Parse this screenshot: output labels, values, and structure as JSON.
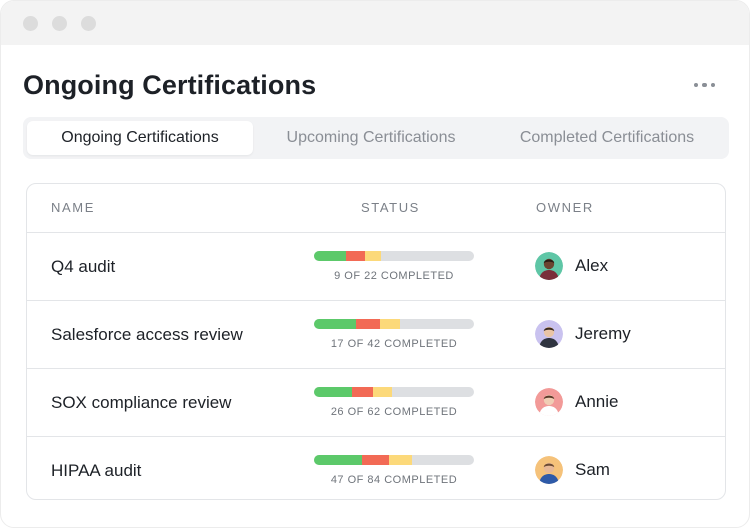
{
  "header": {
    "title": "Ongoing Certifications"
  },
  "tabs": [
    {
      "label": "Ongoing Certifications",
      "active": true
    },
    {
      "label": "Upcoming Certifications",
      "active": false
    },
    {
      "label": "Completed Certifications",
      "active": false
    }
  ],
  "table": {
    "columns": {
      "name": "NAME",
      "status": "STATUS",
      "owner": "OWNER"
    },
    "rows": [
      {
        "name": "Q4 audit",
        "status_text": "9 OF 22 COMPLETED",
        "progress": {
          "green": 0.2,
          "red": 0.12,
          "yellow": 0.1
        },
        "owner": "Alex",
        "avatar_bg": "#5fc6a6",
        "skin": "#6b4430",
        "hair": "#2a1c14",
        "shirt": "#7a2e3a"
      },
      {
        "name": "Salesforce access review",
        "status_text": "17 OF 42 COMPLETED",
        "progress": {
          "green": 0.26,
          "red": 0.15,
          "yellow": 0.13
        },
        "owner": "Jeremy",
        "avatar_bg": "#c9c2ef",
        "skin": "#e9c4a6",
        "hair": "#3a2a20",
        "shirt": "#2f3440"
      },
      {
        "name": "SOX compliance review",
        "status_text": "26 OF 62 COMPLETED",
        "progress": {
          "green": 0.24,
          "red": 0.13,
          "yellow": 0.12
        },
        "owner": "Annie",
        "avatar_bg": "#f29a98",
        "skin": "#f0cdb4",
        "hair": "#5a3a2a",
        "shirt": "#ffffff"
      },
      {
        "name": "HIPAA audit",
        "status_text": "47 OF 84 COMPLETED",
        "progress": {
          "green": 0.3,
          "red": 0.17,
          "yellow": 0.14
        },
        "owner": "Sam",
        "avatar_bg": "#f5c27a",
        "skin": "#e7b896",
        "hair": "#6b4a33",
        "shirt": "#2e5aa8"
      }
    ]
  },
  "colors": {
    "green": "#5cc96a",
    "red": "#f26a55",
    "yellow": "#fcd97a",
    "track": "#dddfe2"
  }
}
